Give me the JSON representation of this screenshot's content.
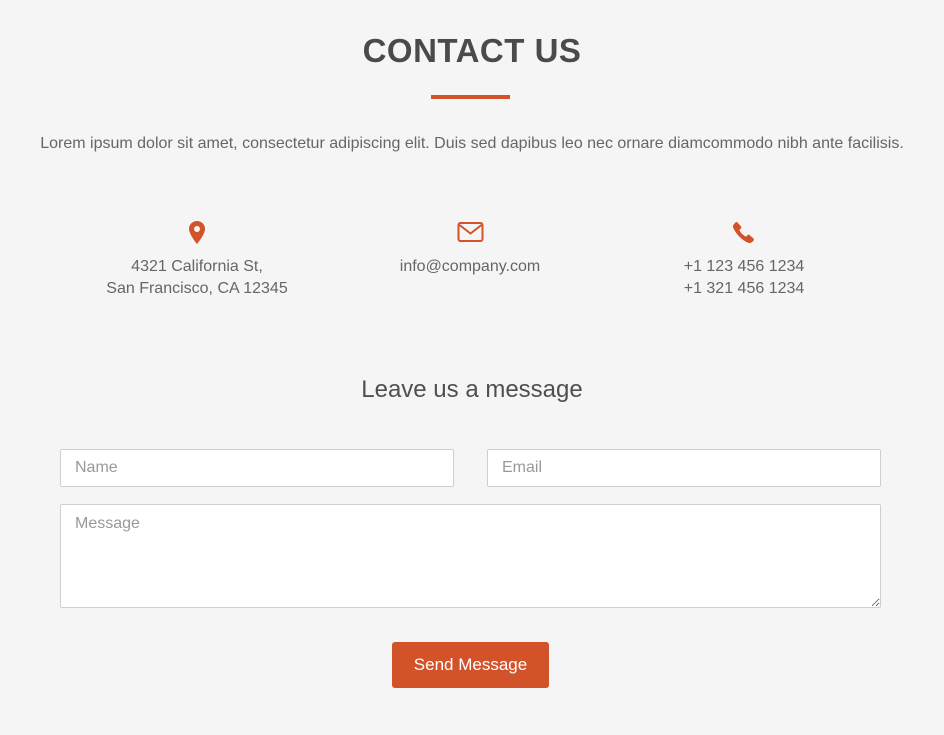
{
  "header": {
    "title": "CONTACT US",
    "intro": "Lorem ipsum dolor sit amet, consectetur adipiscing elit. Duis sed dapibus leo nec ornare diamcommodo nibh ante facilisis."
  },
  "contact_info": {
    "address": {
      "icon": "map-pin-icon",
      "line1": "4321 California St,",
      "line2": "San Francisco, CA 12345"
    },
    "email": {
      "icon": "envelope-icon",
      "value": "info@company.com"
    },
    "phone": {
      "icon": "phone-icon",
      "line1": "+1 123 456 1234",
      "line2": "+1 321 456 1234"
    }
  },
  "form": {
    "heading": "Leave us a message",
    "name_placeholder": "Name",
    "email_placeholder": "Email",
    "message_placeholder": "Message",
    "name_value": "",
    "email_value": "",
    "message_value": "",
    "submit_label": "Send Message"
  },
  "colors": {
    "accent": "#d2522a",
    "background": "#f5f5f5",
    "text": "#666666"
  }
}
